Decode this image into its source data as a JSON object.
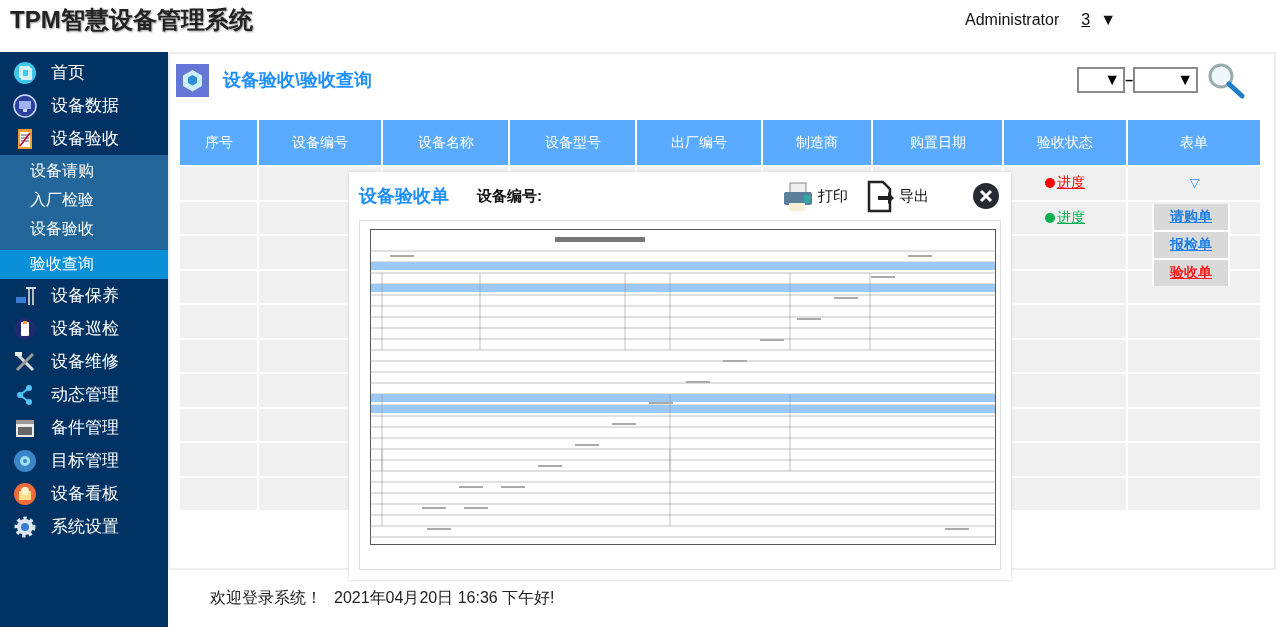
{
  "header": {
    "title": "TPM智慧设备管理系统",
    "user": "Administrator",
    "count": "3",
    "menu_caret": "▼"
  },
  "sidebar": {
    "items": [
      {
        "label": "首页"
      },
      {
        "label": "设备数据"
      },
      {
        "label": "设备验收",
        "expanded": true,
        "children": [
          {
            "label": "设备请购",
            "selected": false
          },
          {
            "label": "入厂检验",
            "selected": false
          },
          {
            "label": "设备验收",
            "selected": false
          },
          {
            "label": "验收查询",
            "selected": true
          }
        ]
      },
      {
        "label": "设备保养"
      },
      {
        "label": "设备巡检"
      },
      {
        "label": "设备维修"
      },
      {
        "label": "动态管理"
      },
      {
        "label": "备件管理"
      },
      {
        "label": "目标管理"
      },
      {
        "label": "设备看板"
      },
      {
        "label": "系统设置"
      }
    ]
  },
  "page": {
    "breadcrumb": "设备验收\\验收查询",
    "filter": {
      "range_separator": "–",
      "from_caret": "▼",
      "to_caret": "▼"
    }
  },
  "table": {
    "columns": [
      "序号",
      "设备编号",
      "设备名称",
      "设备型号",
      "出厂编号",
      "制造商",
      "购置日期",
      "验收状态",
      "表单"
    ],
    "rows": [
      {
        "status": {
          "label": "进度",
          "color": "#ff0000"
        },
        "form_toggle": "▽"
      },
      {
        "status": {
          "label": "进度",
          "color": "#00b050"
        }
      },
      {},
      {},
      {},
      {},
      {},
      {},
      {},
      {}
    ],
    "form_menu": [
      {
        "label": "请购单",
        "selected": false
      },
      {
        "label": "报检单",
        "selected": false
      },
      {
        "label": "验收单",
        "selected": true
      }
    ]
  },
  "dialog": {
    "title": "设备验收单",
    "field_label": "设备编号:",
    "print": "打印",
    "export": "导出"
  },
  "footer": {
    "welcome": "欢迎登录系统！",
    "datetime": "2021年04月20日 16:36 下午好!"
  }
}
